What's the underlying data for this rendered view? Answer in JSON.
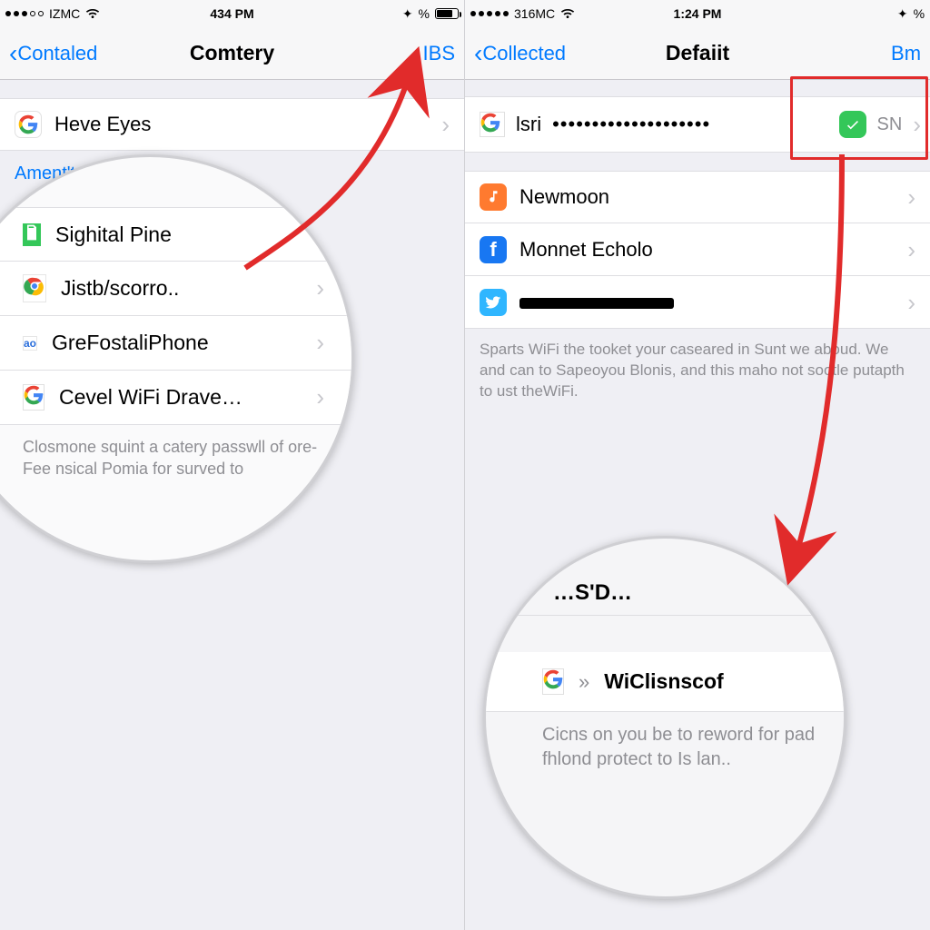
{
  "left": {
    "status": {
      "carrier": "IZMC",
      "time": "434 PM",
      "pct": "%"
    },
    "nav": {
      "back": "Contaled",
      "title": "Comtery",
      "right": "IBS"
    },
    "rows_top": [
      {
        "icon": "google",
        "label": "Heve Eyes"
      }
    ],
    "section_header": "Ament'tese Enibbol",
    "lens": {
      "rows": [
        {
          "icon": "green-paper",
          "label": "Sighital Pine"
        },
        {
          "icon": "chrome",
          "label": "Jistb/scorro.."
        },
        {
          "icon": "ring",
          "label": "GreFostaliPhone"
        },
        {
          "icon": "google",
          "label_pre": "Cevel WiFi ",
          "label_bold": "Drave…"
        }
      ],
      "footer": "Closmone squint a catery passwll of ore-Fee nsical Pomia for surved to"
    }
  },
  "right": {
    "status": {
      "carrier": "316MC",
      "time": "1:24 PM",
      "pct": "%"
    },
    "nav": {
      "back": "Collected",
      "title": "Defaiit",
      "right": "Bm"
    },
    "pw": {
      "label": "lsri",
      "mask": "••••••••••••••••••••",
      "sn": "SN"
    },
    "rows": [
      {
        "icon": "music",
        "label": "Newmoon"
      },
      {
        "icon": "fb",
        "label": "Monnet Echolo"
      },
      {
        "icon": "bird",
        "label_mask": true
      }
    ],
    "footer": "Sparts WiFi the tooket your caseared in Sunt we aboud. We and can to Sapeoyou Blonis, and this maho not sootle putapth to ust theWiFi.",
    "lens": {
      "header": "…S'D…",
      "row": {
        "icon": "google",
        "label": "WiClisnscof",
        "arrow": "»"
      },
      "footer": "Cicns on you be to reword for pad fhlond protect to Is lan.."
    }
  }
}
